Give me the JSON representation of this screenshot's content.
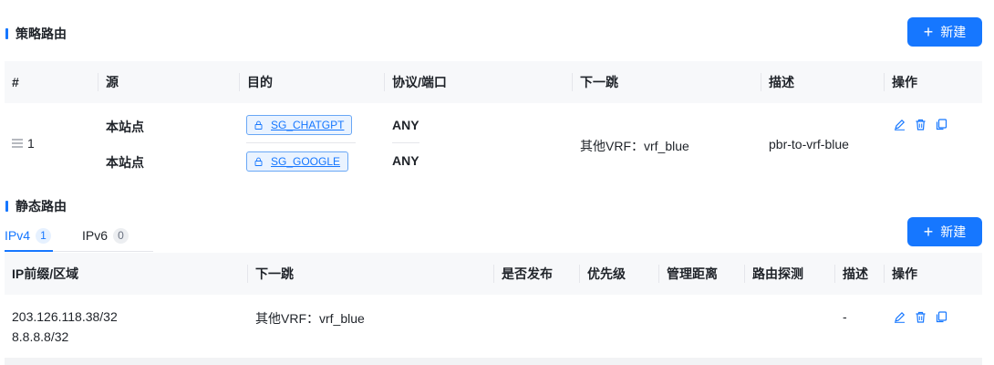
{
  "policy_route": {
    "title": "策略路由",
    "new_button": "新建",
    "columns": [
      "#",
      "源",
      "目的",
      "协议/端口",
      "下一跳",
      "描述",
      "操作"
    ],
    "row": {
      "index": "1",
      "sources": [
        "本站点",
        "本站点"
      ],
      "destinations": [
        "SG_CHATGPT",
        "SG_GOOGLE"
      ],
      "protocols": [
        "ANY",
        "ANY"
      ],
      "next_hop": "其他VRF：vrf_blue",
      "description": "pbr-to-vrf-blue"
    }
  },
  "static_route": {
    "title": "静态路由",
    "new_button": "新建",
    "tabs": [
      {
        "label": "IPv4",
        "count": "1"
      },
      {
        "label": "IPv6",
        "count": "0"
      }
    ],
    "columns": [
      "IP前缀/区域",
      "下一跳",
      "是否发布",
      "优先级",
      "管理距离",
      "路由探测",
      "描述",
      "操作"
    ],
    "row": {
      "prefixes": [
        "203.126.118.38/32",
        "8.8.8.8/32"
      ],
      "next_hop": "其他VRF：vrf_blue",
      "description": "-"
    }
  },
  "colors": {
    "accent": "#1677ff",
    "header_bg": "#f7f8fa",
    "tag_bg": "#eaf3ff"
  }
}
